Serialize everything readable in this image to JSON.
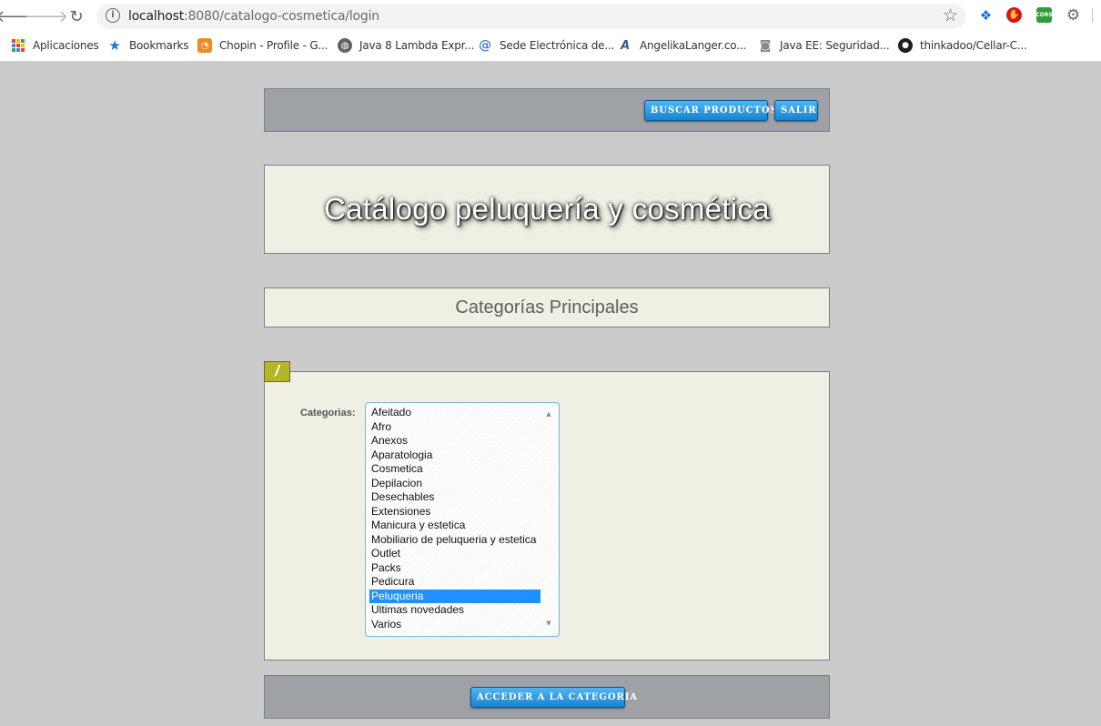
{
  "browser": {
    "url_host": "localhost",
    "url_rest": ":8080/catalogo-cosmetica/login",
    "back_glyph": "🡐",
    "forward_glyph": "🡒",
    "reload_glyph": "↻",
    "info_glyph": "i",
    "star_glyph": "☆",
    "extensions": {
      "dropbox_glyph": "❖",
      "adblock_glyph": "✋",
      "cors_label": "CORS",
      "gear_glyph": "⚙"
    }
  },
  "bookmarks": [
    {
      "label": "Aplicaciones",
      "icon": "apps-grid-icon"
    },
    {
      "label": "Bookmarks",
      "icon": "star-icon"
    },
    {
      "label": "Chopin - Profile - G...",
      "icon": "chopin-icon"
    },
    {
      "label": "Java 8 Lambda Expr...",
      "icon": "globe-icon"
    },
    {
      "label": "Sede Electrónica de...",
      "icon": "at-icon"
    },
    {
      "label": "AngelikaLanger.co...",
      "icon": "al-icon"
    },
    {
      "label": "Java EE: Seguridad...",
      "icon": "camera-icon"
    },
    {
      "label": "thinkadoo/Cellar-C...",
      "icon": "github-icon"
    }
  ],
  "bookmark_glyphs": {
    "star": "★",
    "chopin": "◔",
    "globe": "◍",
    "at": "@",
    "al": "A",
    "camera": "◙",
    "github": "●"
  },
  "topbar": {
    "buscar_label": "BUSCAR PRODUCTOS",
    "salir_label": "SALIR"
  },
  "header": {
    "title": "Catálogo peluquería y cosmética"
  },
  "section": {
    "title": "Categorías Principales",
    "tab_glyph": "/"
  },
  "form": {
    "categorias_label": "Categorias:",
    "categories": [
      "Afeitado",
      "Afro",
      "Anexos",
      "Aparatologia",
      "Cosmetica",
      "Depilacion",
      "Desechables",
      "Extensiones",
      "Manicura y estetica",
      "Mobiliario de peluqueria y estetica",
      "Outlet",
      "Packs",
      "Pedicura",
      "Peluqueria",
      "Ultimas novedades",
      "Varios"
    ],
    "selected_category": "Peluqueria",
    "scroll_up_glyph": "▲",
    "scroll_down_glyph": "▼"
  },
  "bottombar": {
    "acceder_label": "ACCEDER A LA CATEGORIA"
  },
  "colors": {
    "page_bg": "#cbcbcb",
    "bar_bg": "#9ea2a6",
    "panel_bg": "#efefe4",
    "button_blue": "#1882cf",
    "selection_blue": "#1e90ff",
    "tab_olive": "#b5b52a"
  }
}
